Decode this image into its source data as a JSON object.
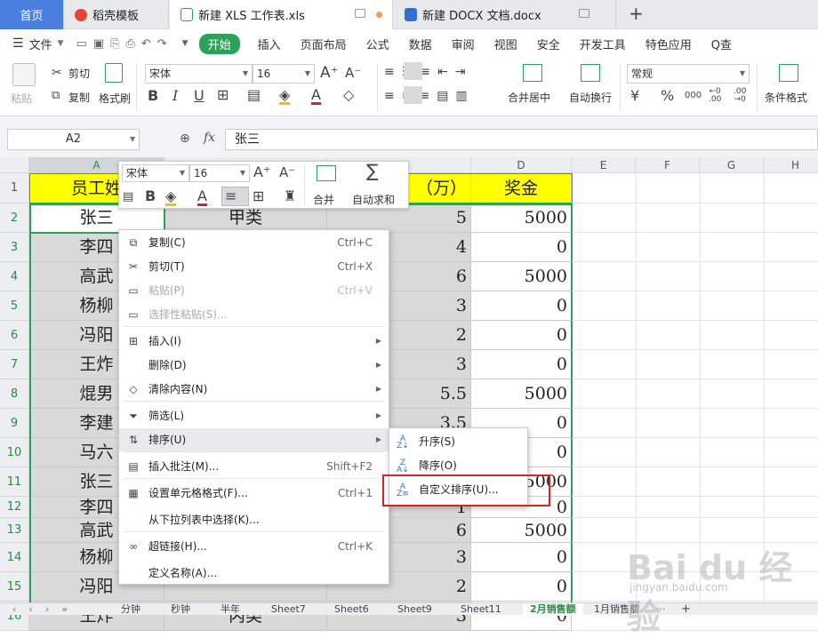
{
  "tabs": {
    "home": "首页",
    "template": "稻壳模板",
    "xls": "新建 XLS 工作表.xls",
    "docx": "新建 DOCX 文档.docx",
    "add": "+"
  },
  "menu": {
    "file": "文件",
    "items": [
      "开始",
      "插入",
      "页面布局",
      "公式",
      "数据",
      "审阅",
      "视图",
      "安全",
      "开发工具",
      "特色应用"
    ],
    "search": "Q查"
  },
  "ribbon": {
    "paste": "粘贴",
    "cut": "剪切",
    "copy": "复制",
    "format_painter": "格式刷",
    "font_name": "宋体",
    "font_size": "16",
    "merge_center": "合并居中",
    "wrap": "自动换行",
    "number_format": "常规",
    "conditional_format": "条件格式"
  },
  "formula": {
    "cell_ref": "A2",
    "fx": "fx",
    "value": "张三"
  },
  "columns": [
    "A",
    "B",
    "C",
    "D",
    "E",
    "F",
    "G",
    "H"
  ],
  "rows": [
    "1",
    "2",
    "3",
    "4",
    "5",
    "6",
    "7",
    "8",
    "9",
    "10",
    "11",
    "12",
    "13",
    "14",
    "15",
    "16"
  ],
  "header_cells": {
    "a": "员工姓",
    "c": "（万）",
    "d": "奖金"
  },
  "col_a": [
    "张三",
    "李四",
    "高武",
    "杨柳",
    "冯阳",
    "王炸",
    "焜男",
    "李建",
    "马六",
    "张三",
    "李四",
    "高武",
    "杨柳",
    "冯阳",
    "王炸"
  ],
  "col_b": {
    "r2": "甲类",
    "r16": "丙类"
  },
  "col_c": [
    "5",
    "4",
    "6",
    "3",
    "2",
    "3",
    "5.5",
    "3.5",
    "",
    "",
    "1",
    "6",
    "3",
    "2",
    "3"
  ],
  "col_d": [
    "5000",
    "0",
    "5000",
    "0",
    "0",
    "0",
    "5000",
    "0",
    "0",
    "5000",
    "0",
    "5000",
    "0",
    "0",
    "0"
  ],
  "mini_toolbar": {
    "font": "宋体",
    "size": "16",
    "merge": "合并",
    "autosum": "自动求和"
  },
  "context_menu": [
    {
      "label": "复制(C)",
      "shortcut": "Ctrl+C",
      "icon": "copy-icon"
    },
    {
      "label": "剪切(T)",
      "shortcut": "Ctrl+X",
      "icon": "scissors-icon"
    },
    {
      "label": "粘贴(P)",
      "shortcut": "Ctrl+V",
      "icon": "paste-icon"
    },
    {
      "label": "选择性粘贴(S)...",
      "shortcut": "",
      "icon": "paste-special-icon"
    },
    {
      "label": "插入(I)",
      "shortcut": "",
      "icon": "insert-icon"
    },
    {
      "label": "删除(D)",
      "shortcut": "",
      "icon": ""
    },
    {
      "label": "清除内容(N)",
      "shortcut": "",
      "icon": "eraser-icon"
    },
    {
      "label": "筛选(L)",
      "shortcut": "",
      "icon": "filter-icon"
    },
    {
      "label": "排序(U)",
      "shortcut": "",
      "icon": "sort-icon"
    },
    {
      "label": "插入批注(M)...",
      "shortcut": "Shift+F2",
      "icon": "comment-icon"
    },
    {
      "label": "设置单元格格式(F)...",
      "shortcut": "Ctrl+1",
      "icon": "format-cells-icon"
    },
    {
      "label": "从下拉列表中选择(K)...",
      "shortcut": "",
      "icon": ""
    },
    {
      "label": "超链接(H)...",
      "shortcut": "Ctrl+K",
      "icon": "link-icon"
    },
    {
      "label": "定义名称(A)...",
      "shortcut": "",
      "icon": ""
    }
  ],
  "sort_submenu": {
    "asc": "升序(S)",
    "desc": "降序(O)",
    "custom": "自定义排序(U)..."
  },
  "sheets": [
    "分钟",
    "秒钟",
    "半年",
    "Sheet7",
    "Sheet6",
    "Sheet9",
    "Sheet11",
    "2月销售额",
    "1月销售额"
  ],
  "watermark": {
    "logo": "Bai du 经验",
    "url": "jingyan.baidu.com"
  }
}
